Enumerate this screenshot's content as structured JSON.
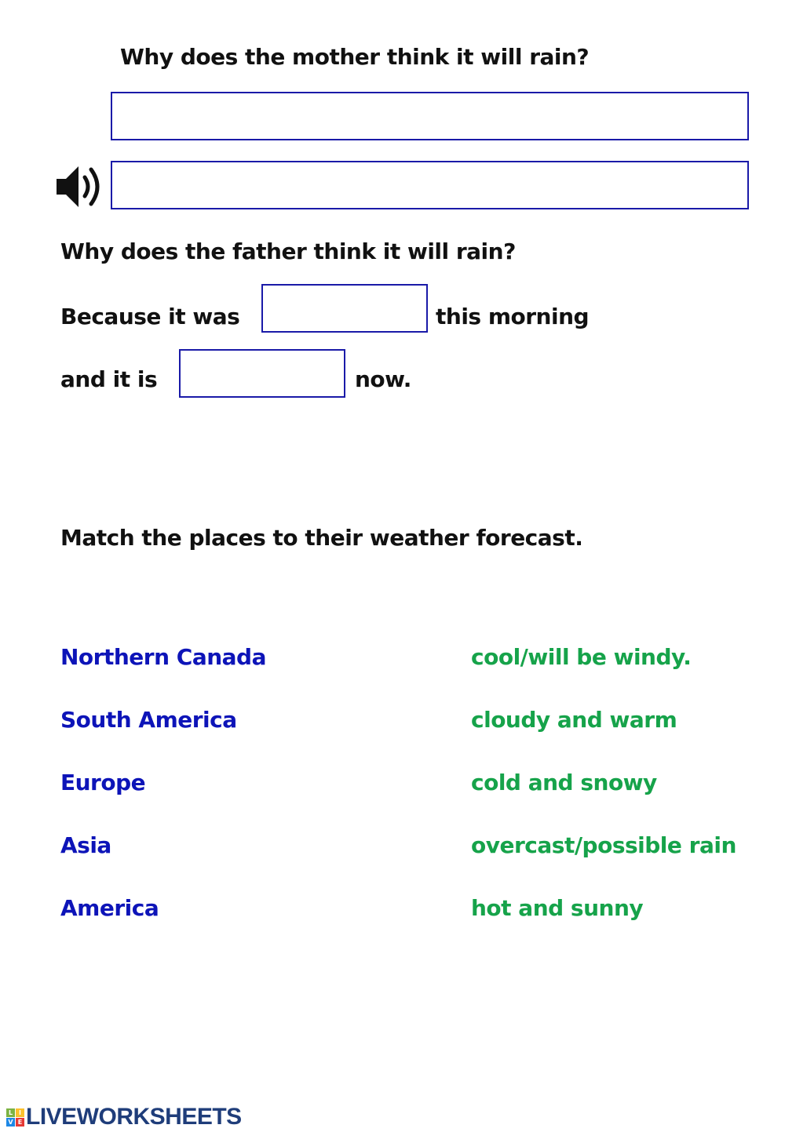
{
  "question1": {
    "prompt": "Why does the mother think it will rain?",
    "answer1_value": "",
    "answer2_value": ""
  },
  "audio": {
    "icon": "speaker-icon"
  },
  "question2": {
    "prompt": "Why does the father think it will rain?",
    "line1_prefix": "Because it was",
    "line1_value": "",
    "line1_suffix": "this morning",
    "line2_prefix": "and it is",
    "line2_value": "",
    "line2_suffix": "now."
  },
  "matching": {
    "instruction": "Match the places to their weather forecast.",
    "places": [
      "Northern Canada",
      "South America",
      "Europe",
      "Asia",
      "America"
    ],
    "forecasts": [
      "cool/will be windy.",
      "cloudy and warm",
      "cold and snowy",
      "overcast/possible rain",
      "hot and sunny"
    ],
    "colors": {
      "places": "#0d14b8",
      "forecasts": "#16a34a",
      "box_border": "#1a1aa8"
    }
  },
  "footer": {
    "logo_letters": [
      "L",
      "I",
      "V",
      "E"
    ],
    "logo_text": "LIVEWORKSHEETS"
  }
}
